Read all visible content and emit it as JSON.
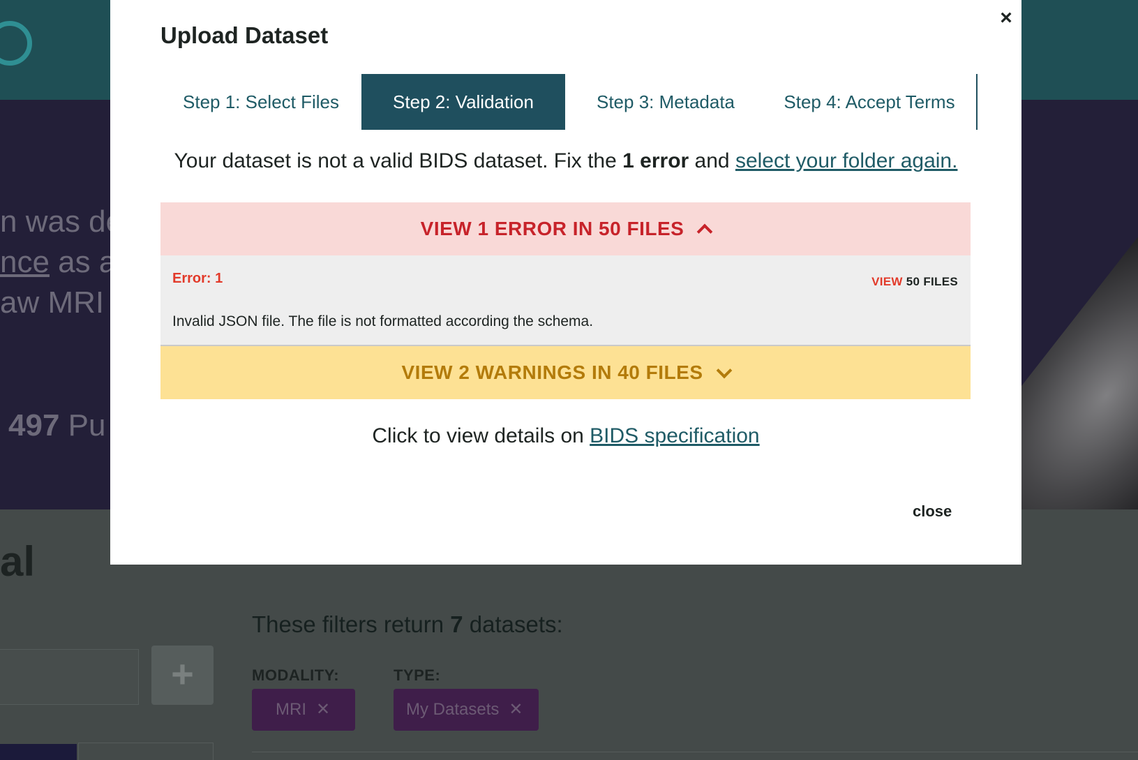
{
  "background": {
    "hero_lines": [
      "n was de",
      "nce",
      " as a",
      "aw MRI c"
    ],
    "stat_number": "497",
    "stat_text": " Pu",
    "section_title_fragment": "al",
    "add_button": "+",
    "filters_prefix": "These filters return ",
    "filters_count": "7",
    "filters_suffix": " datasets:",
    "filter_labels": [
      "MODALITY:",
      "TYPE:"
    ],
    "filter_chips": [
      {
        "label": "MRI",
        "remove": "✕"
      },
      {
        "label": "My Datasets",
        "remove": "✕"
      }
    ]
  },
  "modal": {
    "title": "Upload Dataset",
    "close_x": "×",
    "steps": [
      {
        "label": "Step 1: Select Files",
        "active": false
      },
      {
        "label": "Step 2: Validation",
        "active": true
      },
      {
        "label": "Step 3: Metadata",
        "active": false
      },
      {
        "label": "Step 4: Accept Terms",
        "active": false
      }
    ],
    "message": {
      "prefix": "Your dataset is not a valid BIDS dataset. Fix the ",
      "error_count": "1 error",
      "middle": " and ",
      "link": "select your folder again."
    },
    "errors_header": "VIEW 1 ERROR IN 50 FILES",
    "error_item": {
      "code": "Error: 1",
      "view_label": "VIEW",
      "files_label": "50 FILES",
      "description": "Invalid JSON file. The file is not formatted according the schema."
    },
    "warnings_header": "VIEW 2 WARNINGS IN 40 FILES",
    "spec": {
      "prefix": "Click to view details on ",
      "link": "BIDS specification"
    },
    "close_label": "close"
  },
  "colors": {
    "step_active_bg": "#1f4f5e",
    "error_bg": "#f9d9d7",
    "error_text": "#c7232a",
    "warning_bg": "#fde194",
    "warning_text": "#b37b0a",
    "link": "#1f5b66"
  }
}
